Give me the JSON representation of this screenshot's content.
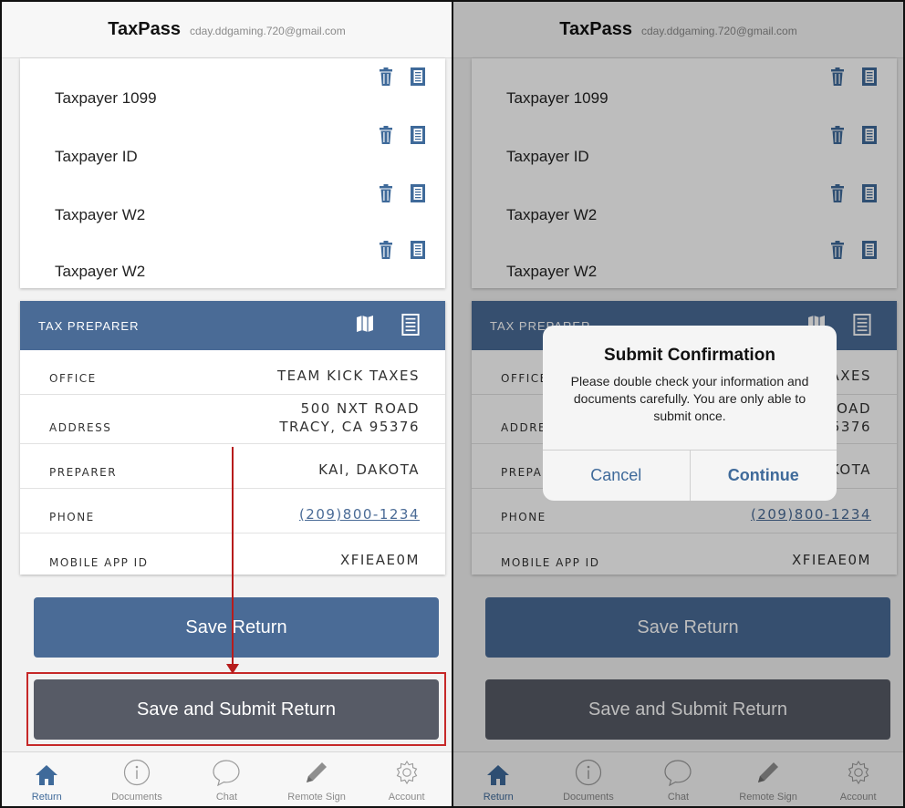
{
  "header": {
    "app_name": "TaxPass",
    "email": "cday.ddgaming.720@gmail.com"
  },
  "documents": [
    {
      "label": "Taxpayer 1099"
    },
    {
      "label": "Taxpayer ID"
    },
    {
      "label": "Taxpayer W2"
    },
    {
      "label": "Taxpayer W2"
    }
  ],
  "preparer": {
    "title": "TAX PREPARER",
    "rows": [
      {
        "key": "OFFICE",
        "value": "TEAM KICK TAXES"
      },
      {
        "key": "ADDRESS",
        "value_line1": "500 NXT ROAD",
        "value_line2": "TRACY, CA 95376"
      },
      {
        "key": "PREPARER",
        "value": "KAI, DAKOTA"
      },
      {
        "key": "PHONE",
        "value": "(209)800-1234"
      },
      {
        "key": "MOBILE APP ID",
        "value": "XFIEAE0M"
      }
    ]
  },
  "buttons": {
    "save": "Save Return",
    "submit": "Save and Submit Return"
  },
  "tabs": [
    {
      "label": "Return",
      "icon": "home-icon",
      "active": true
    },
    {
      "label": "Documents",
      "icon": "info-icon",
      "active": false
    },
    {
      "label": "Chat",
      "icon": "chat-bubble-icon",
      "active": false
    },
    {
      "label": "Remote Sign",
      "icon": "pencil-icon",
      "active": false
    },
    {
      "label": "Account",
      "icon": "gear-icon",
      "active": false
    }
  ],
  "dialog": {
    "title": "Submit Confirmation",
    "message": "Please double check your information and documents carefully. You are only able to submit once.",
    "cancel": "Cancel",
    "continue": "Continue"
  },
  "colors": {
    "accent": "#4a6b96",
    "submit": "#575b66",
    "annotation": "#c62828"
  }
}
